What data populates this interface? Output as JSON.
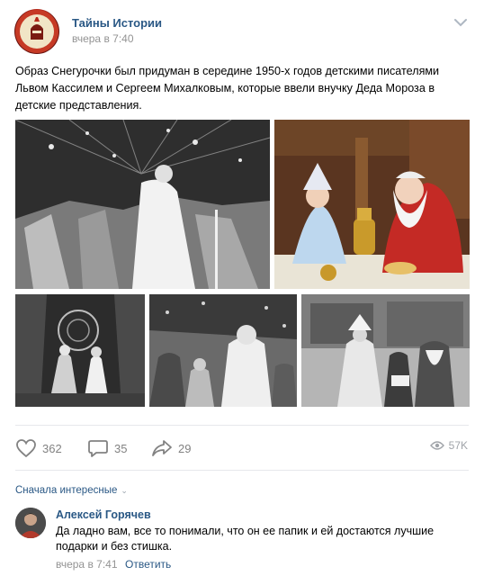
{
  "post": {
    "author": "Тайны Истории",
    "time": "вчера в 7:40",
    "text": "Образ Снегурочки был придуман в середине 1950-х годов детскими писателями Львом Кассилем и Сергеем Михалковым, которые ввели внучку Деда Мороза в детские представления."
  },
  "actions": {
    "likes": "362",
    "comments": "35",
    "shares": "29",
    "views": "57K"
  },
  "comments_section": {
    "sort_label": "Сначала интересные",
    "comment": {
      "author": "Алексей Горячев",
      "text": "Да ладно вам, все то понимали, что он ее папик и ей достаются лучшие подарки и без стишка.",
      "time": "вчера в 7:41",
      "reply_label": "Ответить"
    }
  },
  "colors": {
    "link": "#2a5885",
    "muted": "#939393",
    "icon": "#828282"
  }
}
